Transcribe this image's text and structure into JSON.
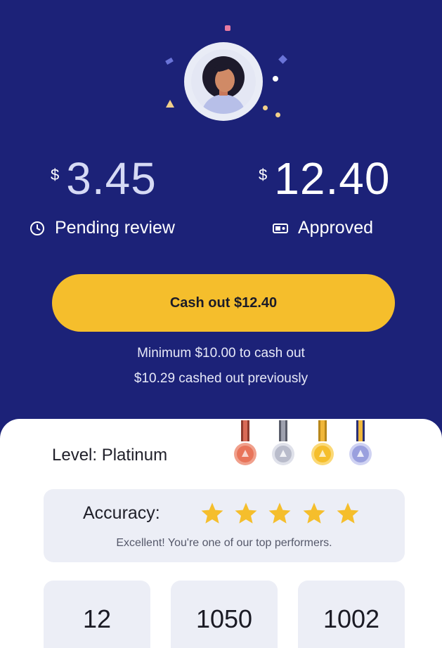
{
  "earnings": {
    "pending": {
      "currency": "$",
      "amount": "3.45",
      "label": "Pending review",
      "icon": "clock-icon"
    },
    "approved": {
      "currency": "$",
      "amount": "12.40",
      "label": "Approved",
      "icon": "cash-icon"
    }
  },
  "cashout": {
    "button_label": "Cash out $12.40",
    "minimum_note": "Minimum $10.00 to cash out",
    "previous_note": "$10.29 cashed out previously"
  },
  "level": {
    "label": "Level: Platinum",
    "medals": [
      {
        "name": "bronze",
        "color": "#e8745a"
      },
      {
        "name": "silver",
        "color": "#b9bccb"
      },
      {
        "name": "gold",
        "color": "#f5be2c"
      },
      {
        "name": "platinum",
        "color": "#9aa0de"
      }
    ]
  },
  "accuracy": {
    "label": "Accuracy:",
    "stars": 5,
    "max_stars": 5,
    "message": "Excellent! You're one of our top performers."
  },
  "stats": [
    {
      "value": "12",
      "label": ""
    },
    {
      "value": "1050",
      "label": ""
    },
    {
      "value": "1002",
      "label": ""
    }
  ],
  "colors": {
    "hero_bg": "#1c2278",
    "accent": "#f5be2c",
    "card_bg": "#eceef6"
  }
}
